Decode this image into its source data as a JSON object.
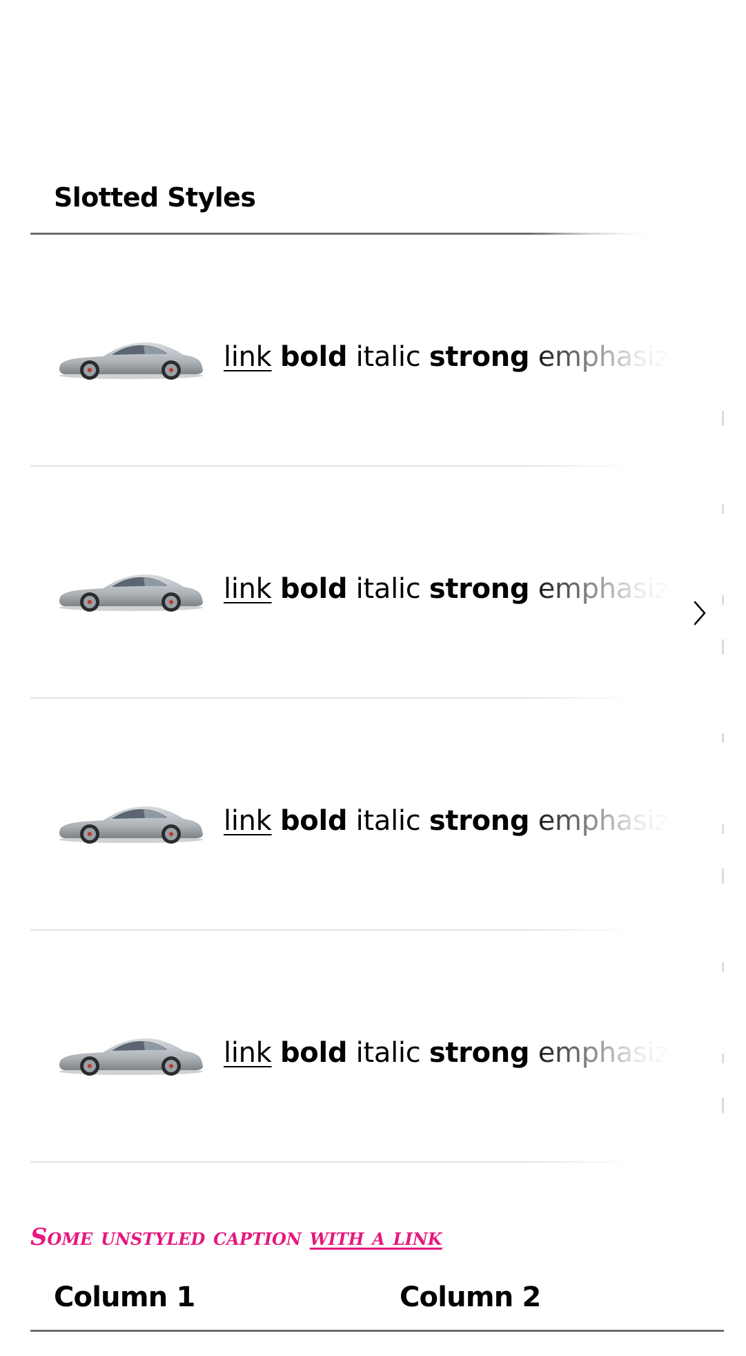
{
  "table1": {
    "header": "Slotted Styles",
    "rows": [
      {
        "image_alt": "Porsche 911",
        "link": "link",
        "bold": "bold",
        "italic": "italic",
        "strong": "strong",
        "emphasized": "emphasized"
      },
      {
        "image_alt": "Porsche 911",
        "link": "link",
        "bold": "bold",
        "italic": "italic",
        "strong": "strong",
        "emphasized": "emphasized"
      },
      {
        "image_alt": "Porsche 911",
        "link": "link",
        "bold": "bold",
        "italic": "italic",
        "strong": "strong",
        "emphasized": "emphasized"
      },
      {
        "image_alt": "Porsche 911",
        "link": "link",
        "bold": "bold",
        "italic": "italic",
        "strong": "strong",
        "emphasized": "emphasized"
      }
    ],
    "scroll_icon": "chevron-right-icon"
  },
  "caption": {
    "text": "Some unstyled caption",
    "link": "with a link"
  },
  "table2": {
    "columns": [
      "Column 1",
      "Column 2"
    ]
  },
  "colors": {
    "caption": "#e5187e",
    "text": "#010205",
    "header_rule": "#6b6d70",
    "row_rule": "#e3e4e5"
  }
}
